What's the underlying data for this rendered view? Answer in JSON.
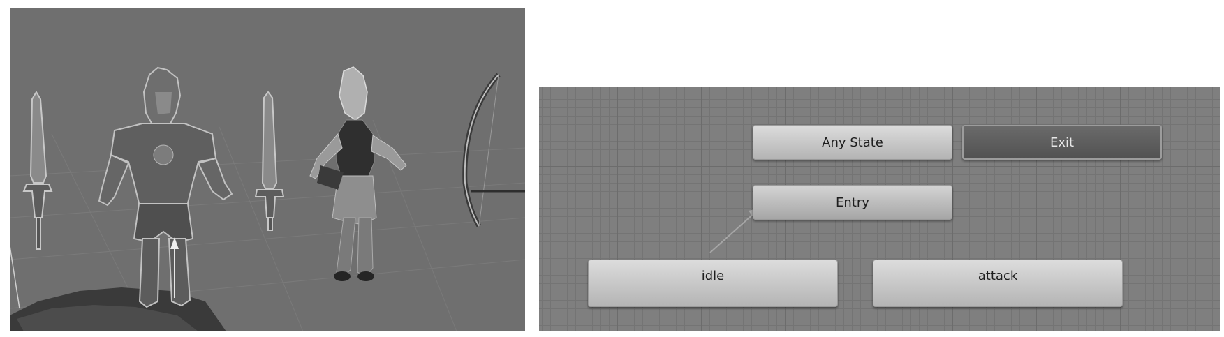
{
  "scene_view": {
    "objects": [
      "warrior-sword",
      "armored-warrior",
      "girl-sword",
      "girl-character",
      "bow"
    ]
  },
  "animator": {
    "states": {
      "any_state": "Any State",
      "exit": "Exit",
      "entry": "Entry",
      "idle": "idle",
      "attack": "attack"
    }
  }
}
